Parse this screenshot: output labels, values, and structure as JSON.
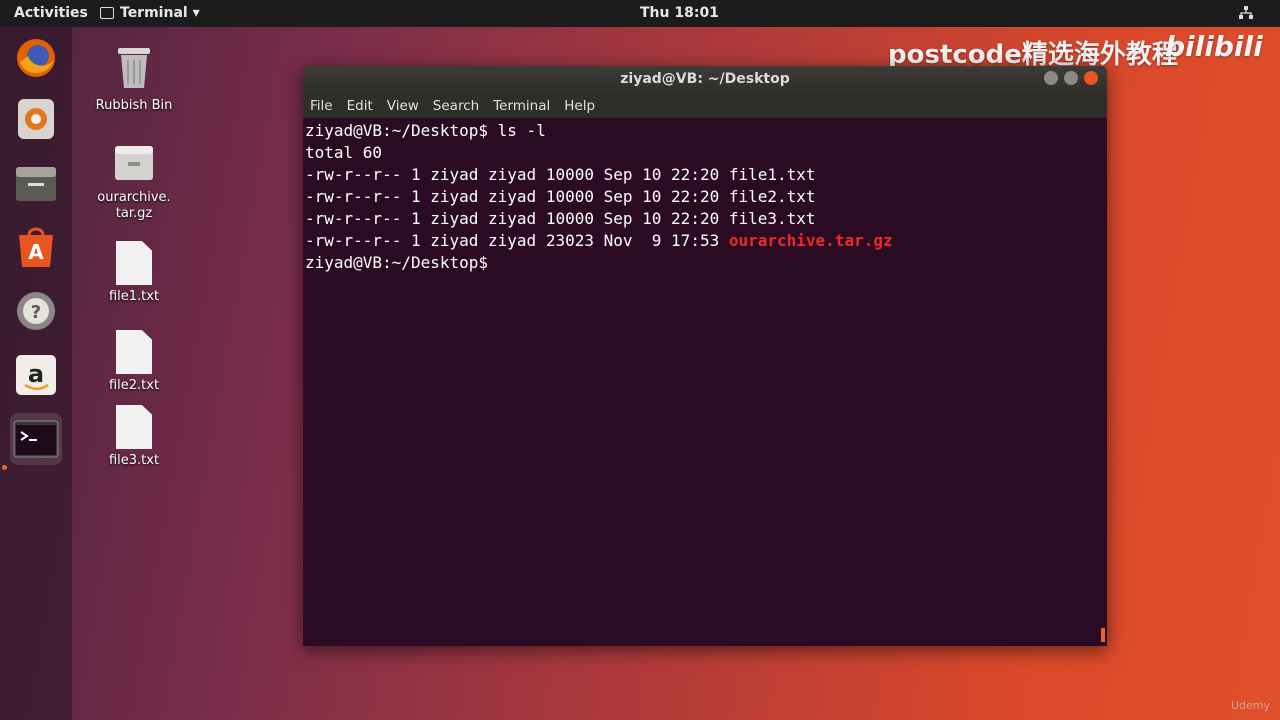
{
  "topbar": {
    "activities": "Activities",
    "app_menu": "Terminal ▾",
    "clock": "Thu 18:01"
  },
  "watermark": {
    "text": "postcode精选海外教程",
    "logo": "bilibili"
  },
  "dock": {
    "items": [
      {
        "icon": "firefox-icon"
      },
      {
        "icon": "rhythmbox-icon"
      },
      {
        "icon": "files-icon"
      },
      {
        "icon": "software-center-icon"
      },
      {
        "icon": "help-icon"
      },
      {
        "icon": "amazon-icon"
      },
      {
        "icon": "terminal-icon"
      }
    ]
  },
  "desktop": {
    "icons": [
      {
        "label": "Rubbish Bin"
      },
      {
        "label": "ourarchive.\ntar.gz"
      },
      {
        "label": "file1.txt"
      },
      {
        "label": "file2.txt"
      },
      {
        "label": "file3.txt"
      }
    ]
  },
  "window": {
    "title": "ziyad@VB: ~/Desktop",
    "menu": [
      "File",
      "Edit",
      "View",
      "Search",
      "Terminal",
      "Help"
    ]
  },
  "terminal": {
    "lines": [
      "ziyad@VB:~/Desktop$ ls -l",
      "total 60",
      "-rw-r--r-- 1 ziyad ziyad 10000 Sep 10 22:20 file1.txt",
      "-rw-r--r-- 1 ziyad ziyad 10000 Sep 10 22:20 file2.txt",
      "-rw-r--r-- 1 ziyad ziyad 10000 Sep 10 22:20 file3.txt"
    ],
    "archive_line_prefix": "-rw-r--r-- 1 ziyad ziyad 23023 Nov  9 17:53 ",
    "archive_name": "ourarchive.tar.gz",
    "prompt": "ziyad@VB:~/Desktop$ "
  },
  "footer": {
    "udemy": "Udemy"
  },
  "colors": {
    "accent": "#e8652b",
    "terminal_bg": "#2b0a24",
    "archive_red": "#ef2929"
  }
}
